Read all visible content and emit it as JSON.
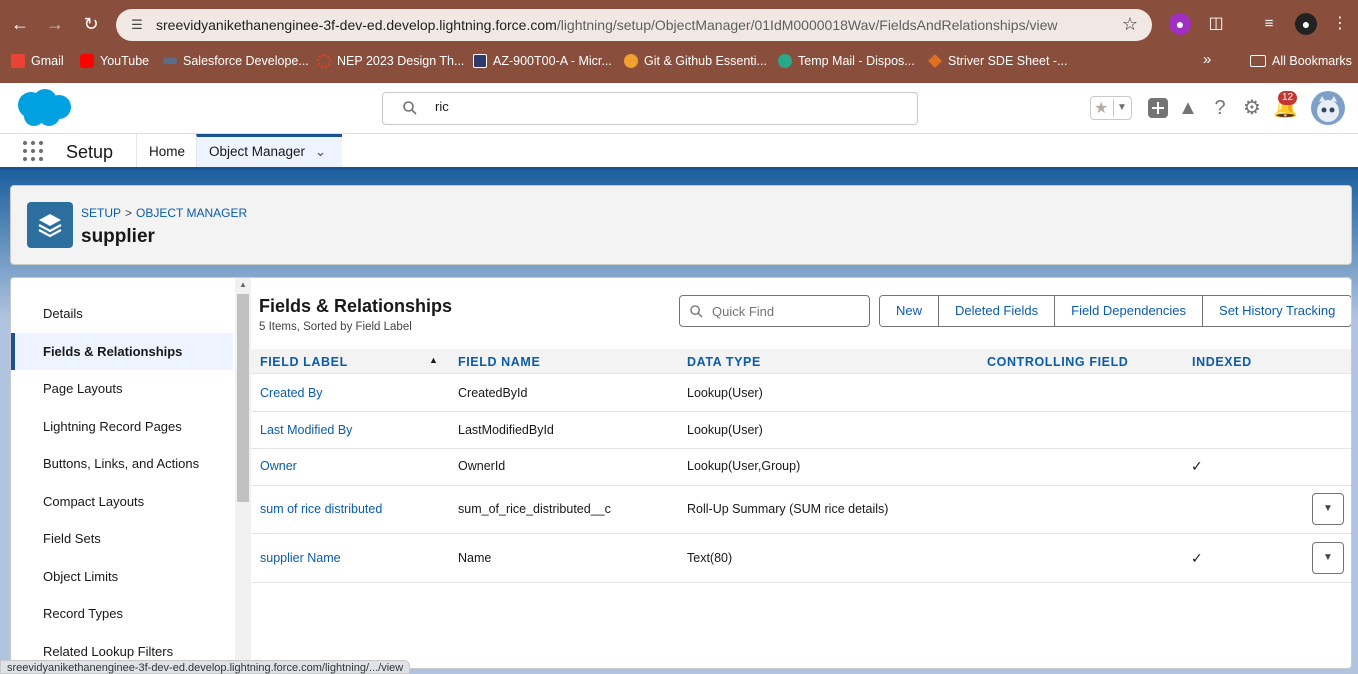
{
  "browser": {
    "url_main": "sreevidyanikethanenginee-3f-dev-ed.develop.lightning.force.com",
    "url_path": "/lightning/setup/ObjectManager/01IdM0000018Wav/FieldsAndRelationships/view",
    "bookmarks": [
      {
        "label": "Gmail",
        "icon": "gmail-icon",
        "color": "#ea4335"
      },
      {
        "label": "YouTube",
        "icon": "youtube-icon",
        "color": "#ff0000"
      },
      {
        "label": "Salesforce Develope...",
        "icon": "salesforce-dev-icon",
        "color": "#5a6b8c"
      },
      {
        "label": "NEP 2023 Design Th...",
        "icon": "nep-icon",
        "color": "#e0402a"
      },
      {
        "label": "AZ-900T00-A - Micr...",
        "icon": "microsoft-icon",
        "color": "#2d3a6a"
      },
      {
        "label": "Git & Github Essenti...",
        "icon": "git-icon",
        "color": "#f0a030"
      },
      {
        "label": "Temp Mail - Dispos...",
        "icon": "tempmail-icon",
        "color": "#2aa889"
      },
      {
        "label": "Striver SDE Sheet -...",
        "icon": "striver-icon",
        "color": "#e07020"
      }
    ],
    "more_label": "»",
    "all_bookmarks": "All Bookmarks",
    "status_url": "sreevidyanikethanenginee-3f-dev-ed.develop.lightning.force.com/lightning/.../view"
  },
  "header": {
    "search_value": "ric",
    "notifications_count": "12"
  },
  "nav": {
    "app_name": "Setup",
    "tabs": [
      {
        "label": "Home"
      },
      {
        "label": "Object Manager"
      }
    ]
  },
  "page_header": {
    "crumb_setup": "SETUP",
    "crumb_sep": ">",
    "crumb_object_manager": "OBJECT MANAGER",
    "object_name": "supplier"
  },
  "sidebar": {
    "items": [
      {
        "label": "Details"
      },
      {
        "label": "Fields & Relationships"
      },
      {
        "label": "Page Layouts"
      },
      {
        "label": "Lightning Record Pages"
      },
      {
        "label": "Buttons, Links, and Actions"
      },
      {
        "label": "Compact Layouts"
      },
      {
        "label": "Field Sets"
      },
      {
        "label": "Object Limits"
      },
      {
        "label": "Record Types"
      },
      {
        "label": "Related Lookup Filters"
      }
    ],
    "active_index": 1
  },
  "fields": {
    "title": "Fields & Relationships",
    "subtitle": "5 Items, Sorted by Field Label",
    "quick_find_placeholder": "Quick Find",
    "buttons": {
      "new": "New",
      "deleted": "Deleted Fields",
      "dependencies": "Field Dependencies",
      "history": "Set History Tracking"
    },
    "columns": {
      "label": "FIELD LABEL",
      "name": "FIELD NAME",
      "type": "DATA TYPE",
      "controlling": "CONTROLLING FIELD",
      "indexed": "INDEXED"
    },
    "rows": [
      {
        "label": "Created By",
        "name": "CreatedById",
        "type": "Lookup(User)",
        "indexed": false,
        "menu": false
      },
      {
        "label": "Last Modified By",
        "name": "LastModifiedById",
        "type": "Lookup(User)",
        "indexed": false,
        "menu": false
      },
      {
        "label": "Owner",
        "name": "OwnerId",
        "type": "Lookup(User,Group)",
        "indexed": true,
        "menu": false
      },
      {
        "label": "sum of rice distributed",
        "name": "sum_of_rice_distributed__c",
        "type": "Roll-Up Summary (SUM rice details)",
        "indexed": false,
        "menu": true
      },
      {
        "label": "supplier Name",
        "name": "Name",
        "type": "Text(80)",
        "indexed": true,
        "menu": true
      }
    ]
  },
  "colors": {
    "brand": "#1b5297",
    "link": "#0b5cab",
    "browser_chrome": "#8a4f3c",
    "salesforce_blue": "#00a1e0"
  }
}
